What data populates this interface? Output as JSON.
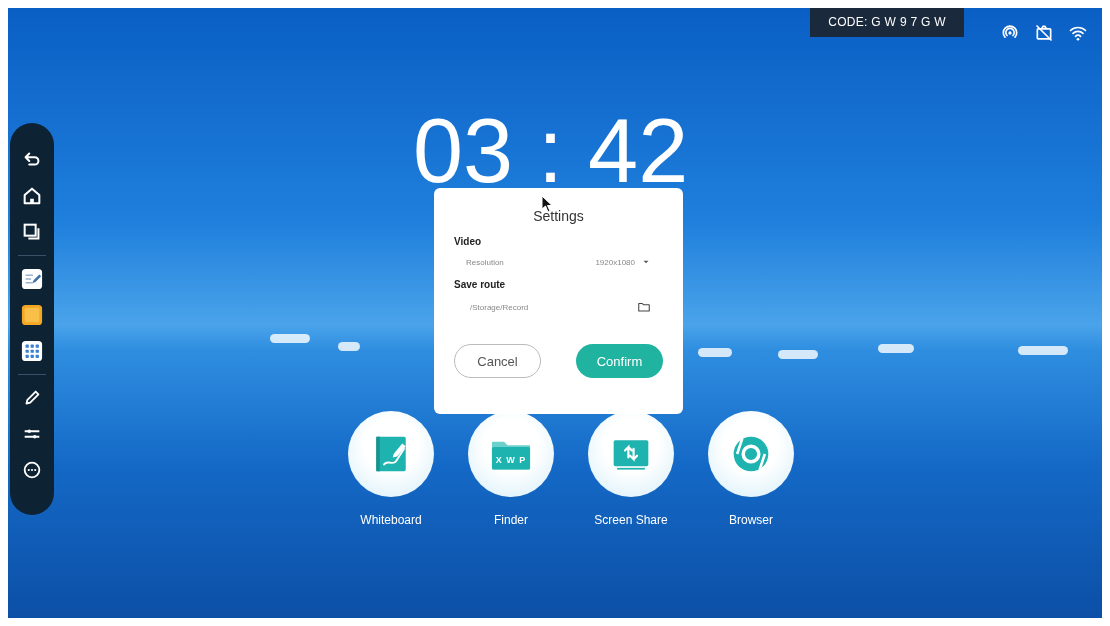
{
  "status_bar": {
    "code": "CODE: G W 9 7 G W"
  },
  "clock": {
    "time": "03 : 42"
  },
  "sidebar": {
    "groups": [
      {
        "items": [
          {
            "kind": "tool"
          },
          {
            "kind": "tool"
          },
          {
            "kind": "tool"
          }
        ]
      },
      {
        "items": [
          {
            "kind": "app"
          },
          {
            "kind": "app"
          },
          {
            "kind": "app"
          }
        ]
      },
      {
        "items": [
          {
            "kind": "tool"
          },
          {
            "kind": "tool"
          },
          {
            "kind": "tool"
          }
        ]
      }
    ]
  },
  "dialog": {
    "title": "Settings",
    "sections": [
      {
        "heading": "Video",
        "kind": "select",
        "label": "Resolution",
        "value": "1920x1080"
      },
      {
        "heading": "Save route",
        "kind": "path",
        "value": "/Storage/Record"
      }
    ],
    "buttons": [
      {
        "label": "Cancel",
        "kind": "secondary"
      },
      {
        "label": "Confirm",
        "kind": "primary"
      }
    ]
  },
  "apps": [
    {
      "label": "Whiteboard"
    },
    {
      "label": "Finder",
      "icon_text": "X W P"
    },
    {
      "label": "Screen Share"
    },
    {
      "label": "Browser"
    }
  ]
}
